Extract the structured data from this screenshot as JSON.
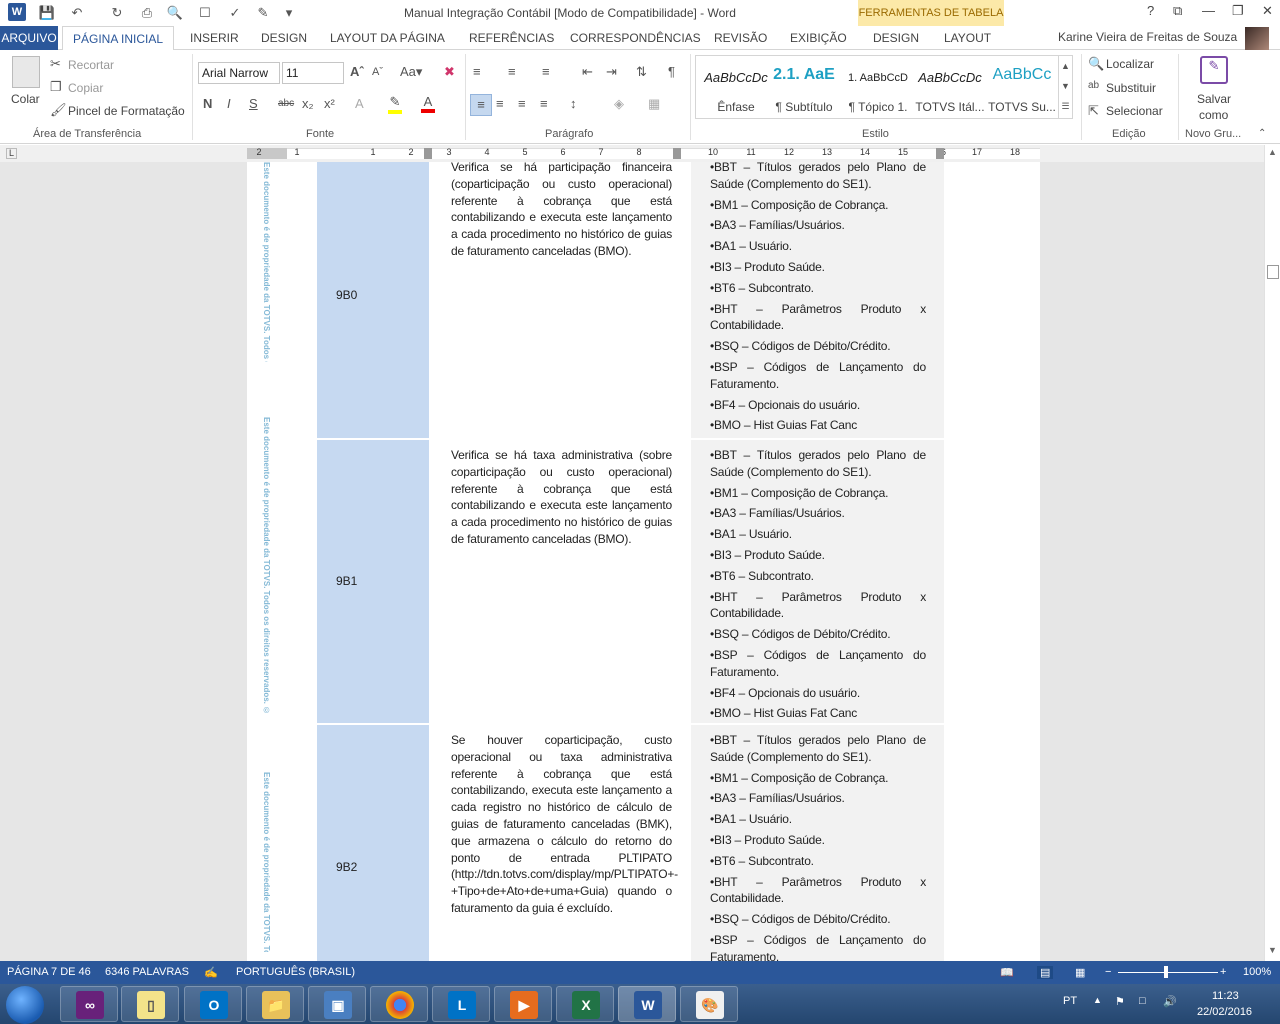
{
  "window": {
    "title": "Manual Integração Contábil [Modo de Compatibilidade] - Word",
    "tool_tab_label": "FERRAMENTAS DE TABELA",
    "help": "?"
  },
  "tabs": [
    "ARQUIVO",
    "PÁGINA INICIAL",
    "INSERIR",
    "DESIGN",
    "LAYOUT DA PÁGINA",
    "REFERÊNCIAS",
    "CORRESPONDÊNCIAS",
    "REVISÃO",
    "EXIBIÇÃO",
    "DESIGN",
    "LAYOUT"
  ],
  "user": "Karine Vieira de Freitas de Souza",
  "ribbon": {
    "clipboard": {
      "paste": "Colar",
      "cut": "Recortar",
      "copy": "Copiar",
      "format_painter": "Pincel de Formatação",
      "label": "Área de Transferência"
    },
    "font": {
      "name": "Arial Narrow",
      "size": "11",
      "label": "Fonte",
      "bold": "N",
      "italic": "I",
      "underline": "S",
      "strike": "abc"
    },
    "paragraph": {
      "label": "Parágrafo"
    },
    "styles": {
      "label": "Estilo",
      "items": [
        {
          "sample": "AaBbCcDc",
          "name": "Ênfase"
        },
        {
          "sample": "2.1. AaE",
          "name": "¶ Subtítulo"
        },
        {
          "sample": "1. AaBbCcD",
          "name": "¶ Tópico 1."
        },
        {
          "sample": "AaBbCcDc",
          "name": "TOTVS Itál..."
        },
        {
          "sample": "AaBbCc",
          "name": "TOTVS Su..."
        }
      ]
    },
    "editing": {
      "find": "Localizar",
      "replace": "Substituir",
      "select": "Selecionar",
      "label": "Edição"
    },
    "newgroup": {
      "save": "Salvar",
      "save2": "como",
      "label": "Novo Gru..."
    }
  },
  "ruler_numbers": [
    "2",
    "1",
    "1",
    "2",
    "3",
    "4",
    "5",
    "6",
    "7",
    "8",
    "9",
    "10",
    "11",
    "12",
    "13",
    "14",
    "15",
    "16",
    "17",
    "18"
  ],
  "watermark": "Este documento é de propriedade da TOTVS. Todos os direitos reservados. ©",
  "rows": [
    {
      "code": "9B0",
      "desc": "Verifica se há participação financeira (coparticipação ou custo operacional) referente à cobrança que está contabilizando e executa este lançamento a cada procedimento no histórico de guias de faturamento canceladas (BMO).",
      "tables": [
        "•BBT – Títulos gerados pelo Plano de Saúde (Complemento do SE1).",
        "•BM1 – Composição de Cobrança.",
        "•BA3 – Famílias/Usuários.",
        "•BA1 – Usuário.",
        "•BI3 – Produto Saúde.",
        "•BT6 – Subcontrato.",
        "•BHT – Parâmetros Produto x Contabilidade.",
        "•BSQ – Códigos de Débito/Crédito.",
        "•BSP – Códigos de Lançamento do Faturamento.",
        "•BF4 – Opcionais do usuário.",
        "•BMO – Hist Guias Fat Canc"
      ]
    },
    {
      "code": "9B1",
      "desc": "Verifica se há taxa administrativa (sobre coparticipação ou custo operacional) referente à cobrança que está contabilizando e executa este lançamento a cada procedimento no histórico de guias de faturamento canceladas (BMO).",
      "tables": [
        "•BBT – Títulos gerados pelo Plano de Saúde (Complemento do SE1).",
        "•BM1 – Composição de Cobrança.",
        "•BA3 – Famílias/Usuários.",
        "•BA1 – Usuário.",
        "•BI3 – Produto Saúde.",
        "•BT6 – Subcontrato.",
        "•BHT – Parâmetros Produto x Contabilidade.",
        "•BSQ – Códigos de Débito/Crédito.",
        "•BSP – Códigos de Lançamento do Faturamento.",
        "•BF4 – Opcionais do usuário.",
        "•BMO – Hist Guias Fat Canc"
      ]
    },
    {
      "code": "9B2",
      "desc": "Se houver coparticipação, custo operacional ou taxa administrativa referente à cobrança que está contabilizando, executa este lançamento a cada registro no histórico de cálculo de guias de faturamento canceladas (BMK), que armazena o cálculo do retorno do ponto de entrada PLTIPATO (http://tdn.totvs.com/display/mp/PLTIPATO+-+Tipo+de+Ato+de+uma+Guia) quando o faturamento da guia é excluído.",
      "tables": [
        "•BBT – Títulos gerados pelo Plano de Saúde (Complemento do SE1).",
        "•BM1 – Composição de Cobrança.",
        "•BA3 – Famílias/Usuários.",
        "•BA1 – Usuário.",
        "•BI3 – Produto Saúde.",
        "•BT6 – Subcontrato.",
        "•BHT – Parâmetros Produto x Contabilidade.",
        "•BSQ – Códigos de Débito/Crédito.",
        "•BSP – Códigos de Lançamento do Faturamento."
      ]
    }
  ],
  "status": {
    "page": "PÁGINA 7 DE 46",
    "words": "6346 PALAVRAS",
    "language": "PORTUGUÊS (BRASIL)",
    "zoom": "100%"
  },
  "taskbar": {
    "lang": "PT",
    "time": "11:23",
    "date": "22/02/2016"
  }
}
